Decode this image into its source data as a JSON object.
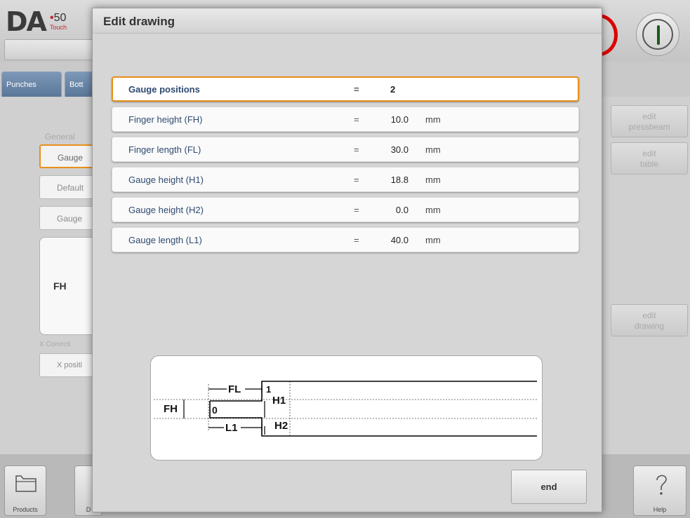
{
  "background": {
    "logo": {
      "brand": "DA",
      "model": "50",
      "sub": "Touch"
    },
    "tabs": [
      "Punches",
      "Bott"
    ],
    "general_label": "General",
    "items": [
      "Gauge",
      "Default",
      "Gauge"
    ],
    "drawing_label": "FH",
    "xcorr_label": "X Correcti",
    "x_position": "X positi",
    "right_buttons": [
      {
        "line1": "edit",
        "line2": "pressbeam"
      },
      {
        "line1": "edit",
        "line2": "table"
      },
      {
        "line1": "edit",
        "line2": "drawing"
      }
    ],
    "bottom_buttons": {
      "products": "Products",
      "second": "D",
      "help": "Help"
    }
  },
  "dialog": {
    "title": "Edit drawing",
    "parameters": [
      {
        "label": "Gauge positions",
        "eq": "=",
        "value": "2",
        "unit": ""
      },
      {
        "label": "Finger height (FH)",
        "eq": "=",
        "value": "10.0",
        "unit": "mm"
      },
      {
        "label": "Finger length (FL)",
        "eq": "=",
        "value": "30.0",
        "unit": "mm"
      },
      {
        "label": "Gauge height (H1)",
        "eq": "=",
        "value": "18.8",
        "unit": "mm"
      },
      {
        "label": "Gauge height (H2)",
        "eq": "=",
        "value": "0.0",
        "unit": "mm"
      },
      {
        "label": "Gauge length (L1)",
        "eq": "=",
        "value": "40.0",
        "unit": "mm"
      }
    ],
    "drawing": {
      "fl": "FL",
      "fh": "FH",
      "l1": "L1",
      "h1": "H1",
      "h2": "H2",
      "pos0": "0",
      "pos1": "1"
    },
    "end_label": "end"
  },
  "colors": {
    "accent_selected": "#e8901a",
    "label_blue": "#2f4a70",
    "red": "#d00000"
  }
}
